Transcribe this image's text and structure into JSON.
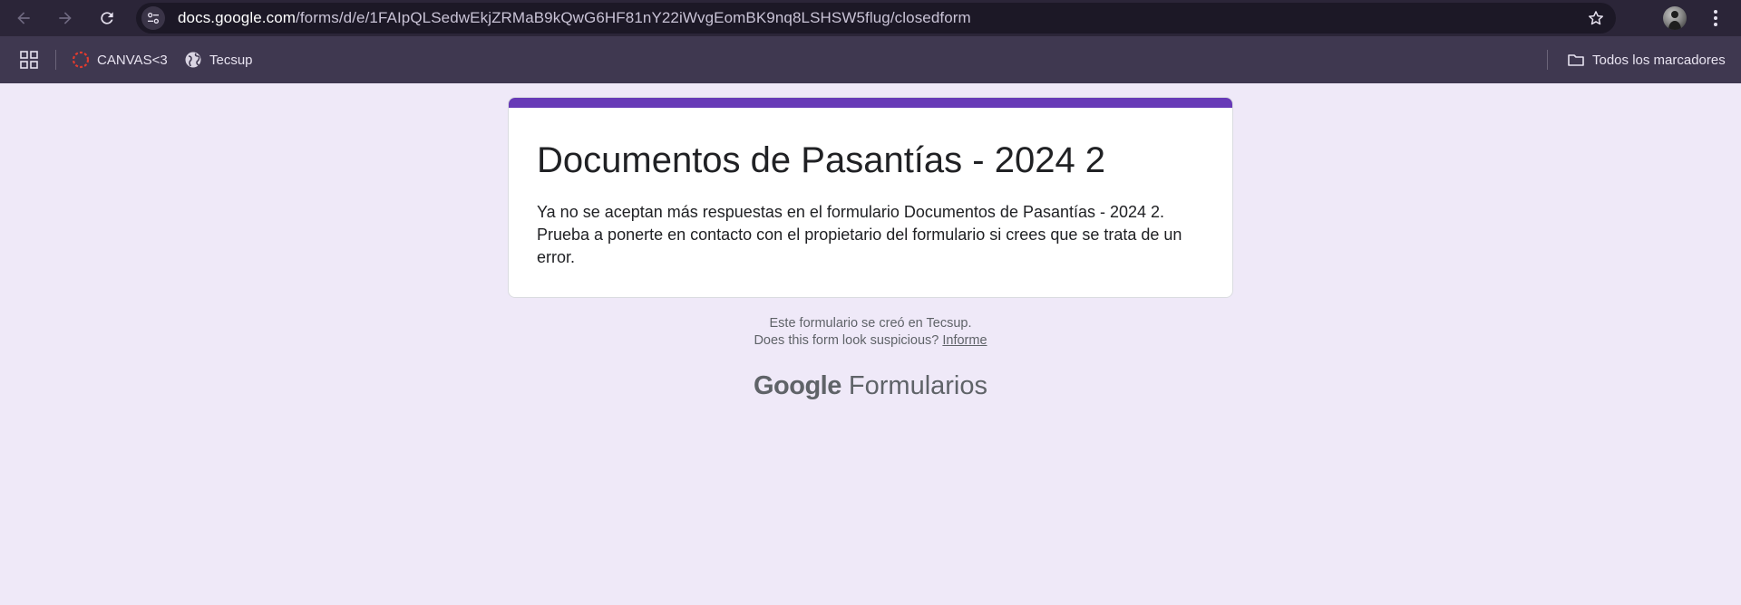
{
  "browser": {
    "url_host": "docs.google.com",
    "url_path": "/forms/d/e/1FAIpQLSedwEkjZRMaB9kQwG6HF81nY22iWvgEomBK9nq8LSHSW5flug/closedform",
    "icons": {
      "back": "arrow-left-icon",
      "forward": "arrow-right-icon",
      "reload": "reload-icon",
      "site_info": "tune-icon",
      "bookmark": "star-icon",
      "menu": "kebab-menu-icon"
    }
  },
  "bookmarks": {
    "items": [
      {
        "label": "CANVAS<3",
        "icon": "canvas-icon"
      },
      {
        "label": "Tecsup",
        "icon": "globe-icon"
      }
    ],
    "all_bookmarks": "Todos los marcadores"
  },
  "form": {
    "title": "Documentos de Pasantías - 2024 2",
    "message": "Ya no se aceptan más respuestas en el formulario Documentos de Pasantías - 2024 2. Prueba a ponerte en contacto con el propietario del formulario si crees que se trata de un error."
  },
  "footer": {
    "created_in": "Este formulario se creó en Tecsup.",
    "suspicious": "Does this form look suspicious?",
    "report": "Informe"
  },
  "brand": {
    "google": "Google",
    "product": "Formularios"
  },
  "colors": {
    "accent": "#673ab7",
    "page_bg": "#efe9f8",
    "toolbar_bg": "#2b2538",
    "bookmarks_bg": "#3f3850"
  }
}
